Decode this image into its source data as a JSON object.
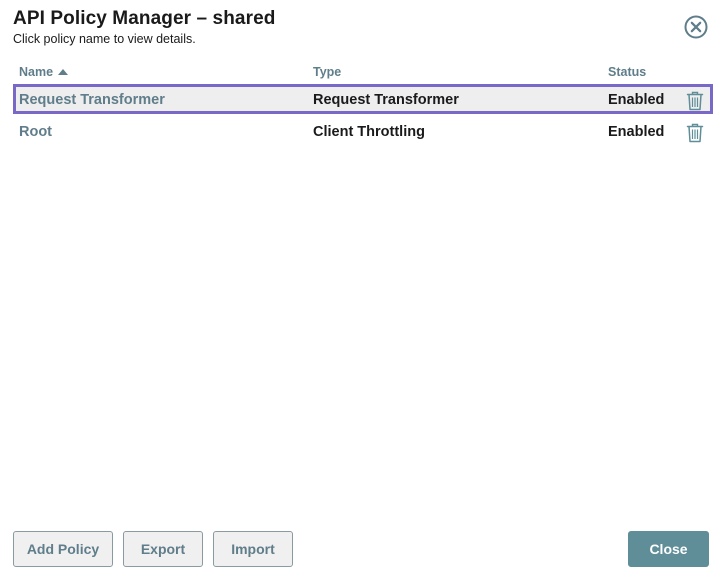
{
  "dialog": {
    "title": "API Policy Manager – shared",
    "subtitle": "Click policy name to view details."
  },
  "table": {
    "columns": {
      "name": "Name",
      "type": "Type",
      "status": "Status"
    },
    "sort": {
      "column": "name",
      "direction": "ascending"
    },
    "rows": [
      {
        "name": "Request Transformer",
        "type": "Request Transformer",
        "status": "Enabled",
        "selected": true
      },
      {
        "name": "Root",
        "type": "Client Throttling",
        "status": "Enabled",
        "selected": false
      }
    ]
  },
  "footer": {
    "add_policy_label": "Add Policy",
    "export_label": "Export",
    "import_label": "Import",
    "close_label": "Close"
  },
  "icons": {
    "close": "close-circle-icon",
    "delete": "trash-icon",
    "sort": "sort-ascending-icon"
  },
  "colors": {
    "accent": "#5f7d8a",
    "primary_button": "#5f8d98",
    "selection_border": "#7a68c8",
    "selected_row_bg": "#eeeeee"
  }
}
